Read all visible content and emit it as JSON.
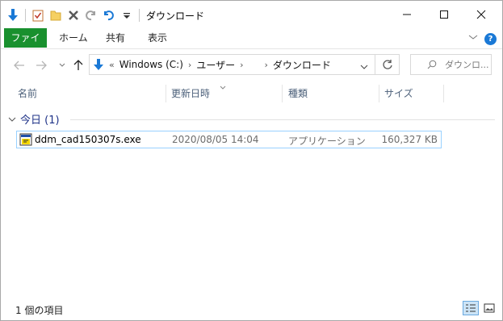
{
  "window": {
    "title": "ダウンロード"
  },
  "ribbon": {
    "tabs": [
      "ファイル",
      "ホーム",
      "共有",
      "表示"
    ],
    "help": "?"
  },
  "address": {
    "crumbs": [
      "Windows (C:)",
      "ユーザー",
      "",
      "ダウンロード"
    ],
    "overflow": "«"
  },
  "search": {
    "placeholder": "ダウンロ..."
  },
  "columns": {
    "name": "名前",
    "modified": "更新日時",
    "type": "種類",
    "size": "サイズ"
  },
  "group": {
    "label": "今日 (1)"
  },
  "files": [
    {
      "name": "ddm_cad150307s.exe",
      "modified": "2020/08/05 14:04",
      "type": "アプリケーション",
      "size": "160,327 KB"
    }
  ],
  "status": {
    "item_count": "1 個の項目"
  },
  "colors": {
    "file_tab": "#19902e",
    "accent_blue": "#1a79d6",
    "selection_border": "#99d1ff",
    "group_text": "#1e3287",
    "header_text": "#4c607a"
  }
}
